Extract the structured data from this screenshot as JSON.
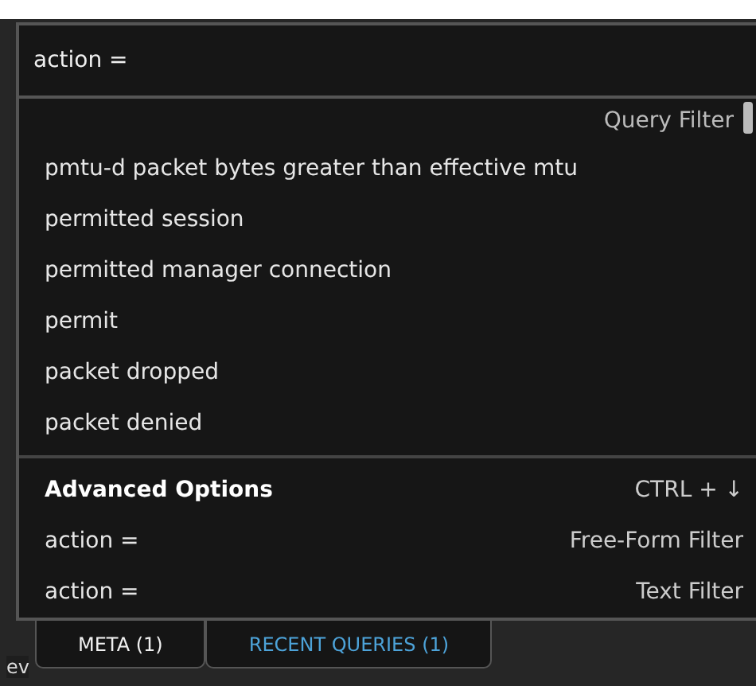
{
  "search": {
    "value": "action ="
  },
  "suggestions": {
    "header": "Query Filter",
    "items": [
      {
        "label": "pmtu-d packet bytes greater than effective mtu"
      },
      {
        "label": "permitted session"
      },
      {
        "label": "permitted manager connection"
      },
      {
        "label": "permit"
      },
      {
        "label": "packet dropped"
      },
      {
        "label": "packet denied"
      }
    ]
  },
  "advanced": {
    "title": "Advanced Options",
    "shortcut": "CTRL + ↓",
    "items": [
      {
        "label": "action =",
        "type": "Free-Form Filter"
      },
      {
        "label": "action =",
        "type": "Text Filter"
      }
    ]
  },
  "tabs": [
    {
      "label": "META (1)",
      "selected": true
    },
    {
      "label": "RECENT QUERIES (1)",
      "selected": false
    }
  ],
  "background_text": "ev"
}
